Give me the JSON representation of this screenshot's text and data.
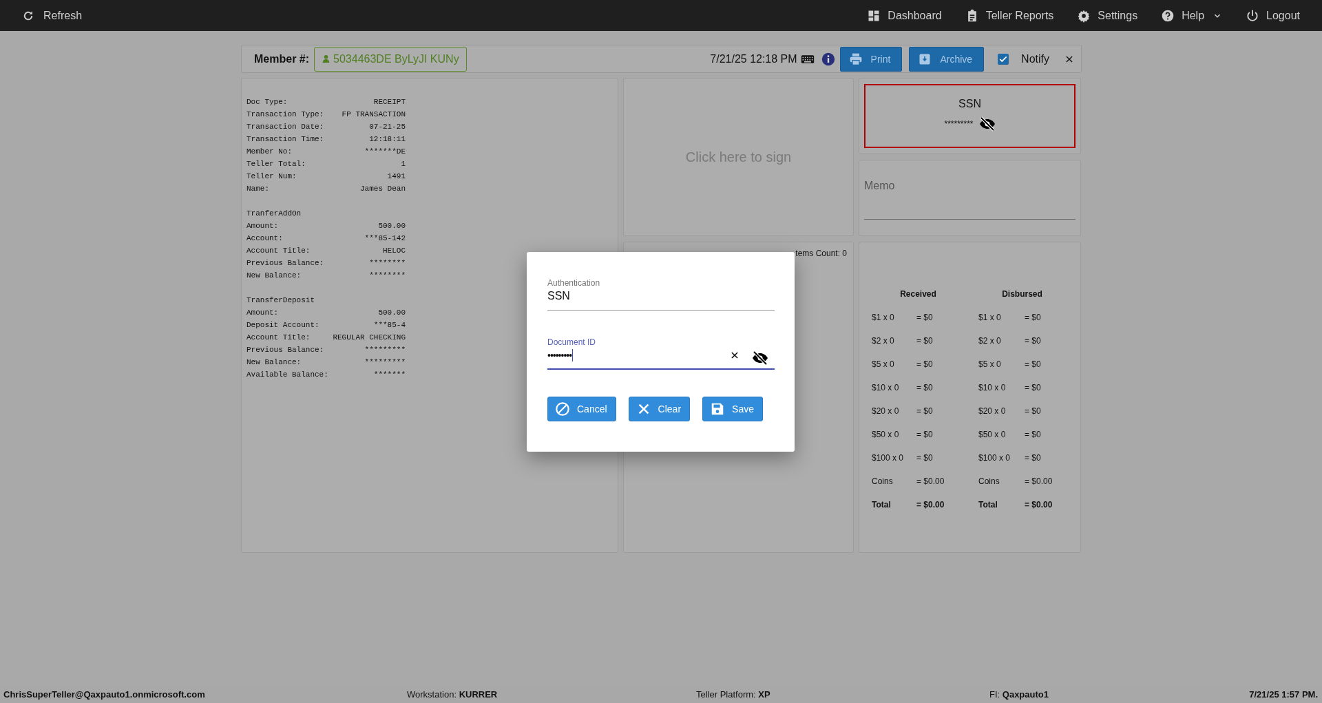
{
  "top_bar": {
    "refresh": "Refresh",
    "nav": [
      {
        "kind": "dashboard",
        "label": "Dashboard",
        "dropdown": false
      },
      {
        "kind": "reports",
        "label": "Teller Reports",
        "dropdown": false
      },
      {
        "kind": "settings",
        "label": "Settings",
        "dropdown": false
      },
      {
        "kind": "help",
        "label": "Help",
        "dropdown": true
      },
      {
        "kind": "logout",
        "label": "Logout",
        "dropdown": false
      }
    ]
  },
  "member_bar": {
    "label": "Member #:",
    "member": "5034463DE ByLyJI KUNy",
    "datetime": "7/21/25 12:18 PM",
    "buttons": [
      {
        "kind": "print",
        "label": "Print"
      },
      {
        "kind": "archive",
        "label": "Archive"
      }
    ],
    "notify": {
      "label": "Notify",
      "checked": true
    }
  },
  "receipt": {
    "sections": [
      {
        "rows": [
          {
            "label": "Doc Type:",
            "value": "RECEIPT"
          },
          {
            "label": "Transaction Type:",
            "value": "FP TRANSACTION"
          },
          {
            "label": "Transaction Date:",
            "value": "07-21-25"
          },
          {
            "label": "Transaction Time:",
            "value": "12:18:11"
          },
          {
            "label": "Member No:",
            "value": "*******DE"
          },
          {
            "label": "Teller Total:",
            "value": "1"
          },
          {
            "label": "Teller Num:",
            "value": "1491"
          },
          {
            "label": "Name:",
            "value": "James Dean"
          }
        ]
      },
      {
        "heading": "TranferAddOn",
        "rows": [
          {
            "label": "Amount:",
            "value": "500.00"
          },
          {
            "label": "Account:",
            "value": "***85-142"
          },
          {
            "label": "Account Title:",
            "value": "HELOC"
          },
          {
            "label": "Previous Balance:",
            "value": "********"
          },
          {
            "label": "New Balance:",
            "value": "********"
          }
        ]
      },
      {
        "heading": "TransferDeposit",
        "rows": [
          {
            "label": "Amount:",
            "value": "500.00"
          },
          {
            "label": "Deposit Account:",
            "value": "***85-4"
          },
          {
            "label": "Account Title:",
            "value": "REGULAR CHECKING"
          },
          {
            "label": "Previous Balance:",
            "value": "*********"
          },
          {
            "label": "New Balance:",
            "value": "*********"
          },
          {
            "label": "Available Balance:",
            "value": "*******"
          }
        ]
      }
    ]
  },
  "signature": {
    "prompt": "Click here to sign"
  },
  "ssn_panel": {
    "title": "SSN",
    "value": "*********",
    "masked": true
  },
  "memo": {
    "label": "Memo"
  },
  "scanned": {
    "count_text": "tems Count: 0"
  },
  "cash": {
    "columns": [
      {
        "title": "Received",
        "rows": [
          {
            "kind": "line",
            "label": "$1 x 0",
            "value": "= $0"
          },
          {
            "kind": "line",
            "label": "$2 x 0",
            "value": "= $0"
          },
          {
            "kind": "line",
            "label": "$5 x 0",
            "value": "= $0"
          },
          {
            "kind": "line",
            "label": "$10 x 0",
            "value": "= $0"
          },
          {
            "kind": "line",
            "label": "$20 x 0",
            "value": "= $0"
          },
          {
            "kind": "line",
            "label": "$50 x 0",
            "value": "= $0"
          },
          {
            "kind": "line",
            "label": "$100 x 0",
            "value": "= $0"
          },
          {
            "kind": "line",
            "label": "Coins",
            "value": "= $0.00"
          },
          {
            "kind": "total",
            "label": "Total",
            "value": "= $0.00"
          }
        ]
      },
      {
        "title": "Disbursed",
        "rows": [
          {
            "kind": "line",
            "label": "$1 x 0",
            "value": "= $0"
          },
          {
            "kind": "line",
            "label": "$2 x 0",
            "value": "= $0"
          },
          {
            "kind": "line",
            "label": "$5 x 0",
            "value": "= $0"
          },
          {
            "kind": "line",
            "label": "$10 x 0",
            "value": "= $0"
          },
          {
            "kind": "line",
            "label": "$20 x 0",
            "value": "= $0"
          },
          {
            "kind": "line",
            "label": "$50 x 0",
            "value": "= $0"
          },
          {
            "kind": "line",
            "label": "$100 x 0",
            "value": "= $0"
          },
          {
            "kind": "line",
            "label": "Coins",
            "value": "= $0.00"
          },
          {
            "kind": "total",
            "label": "Total",
            "value": "= $0.00"
          }
        ]
      }
    ]
  },
  "modal": {
    "fields": [
      {
        "label": "Authentication",
        "value": "SSN",
        "focused": false,
        "clearable": false,
        "masked": false
      },
      {
        "label": "Document ID",
        "value": "•••••••••",
        "focused": true,
        "clearable": true,
        "masked": true
      }
    ],
    "buttons": [
      {
        "kind": "cancel",
        "label": "Cancel"
      },
      {
        "kind": "clear",
        "label": "Clear"
      },
      {
        "kind": "save",
        "label": "Save"
      }
    ]
  },
  "status_bar": [
    {
      "value": "ChrisSuperTeller@Qaxpauto1.onmicrosoft.com"
    },
    {
      "label": "Workstation:",
      "value": "KURRER"
    },
    {
      "label": "Teller Platform:",
      "value": "XP"
    },
    {
      "label": "FI:",
      "value": "Qaxpauto1"
    },
    {
      "value": "7/21/25 1:57 PM."
    }
  ]
}
